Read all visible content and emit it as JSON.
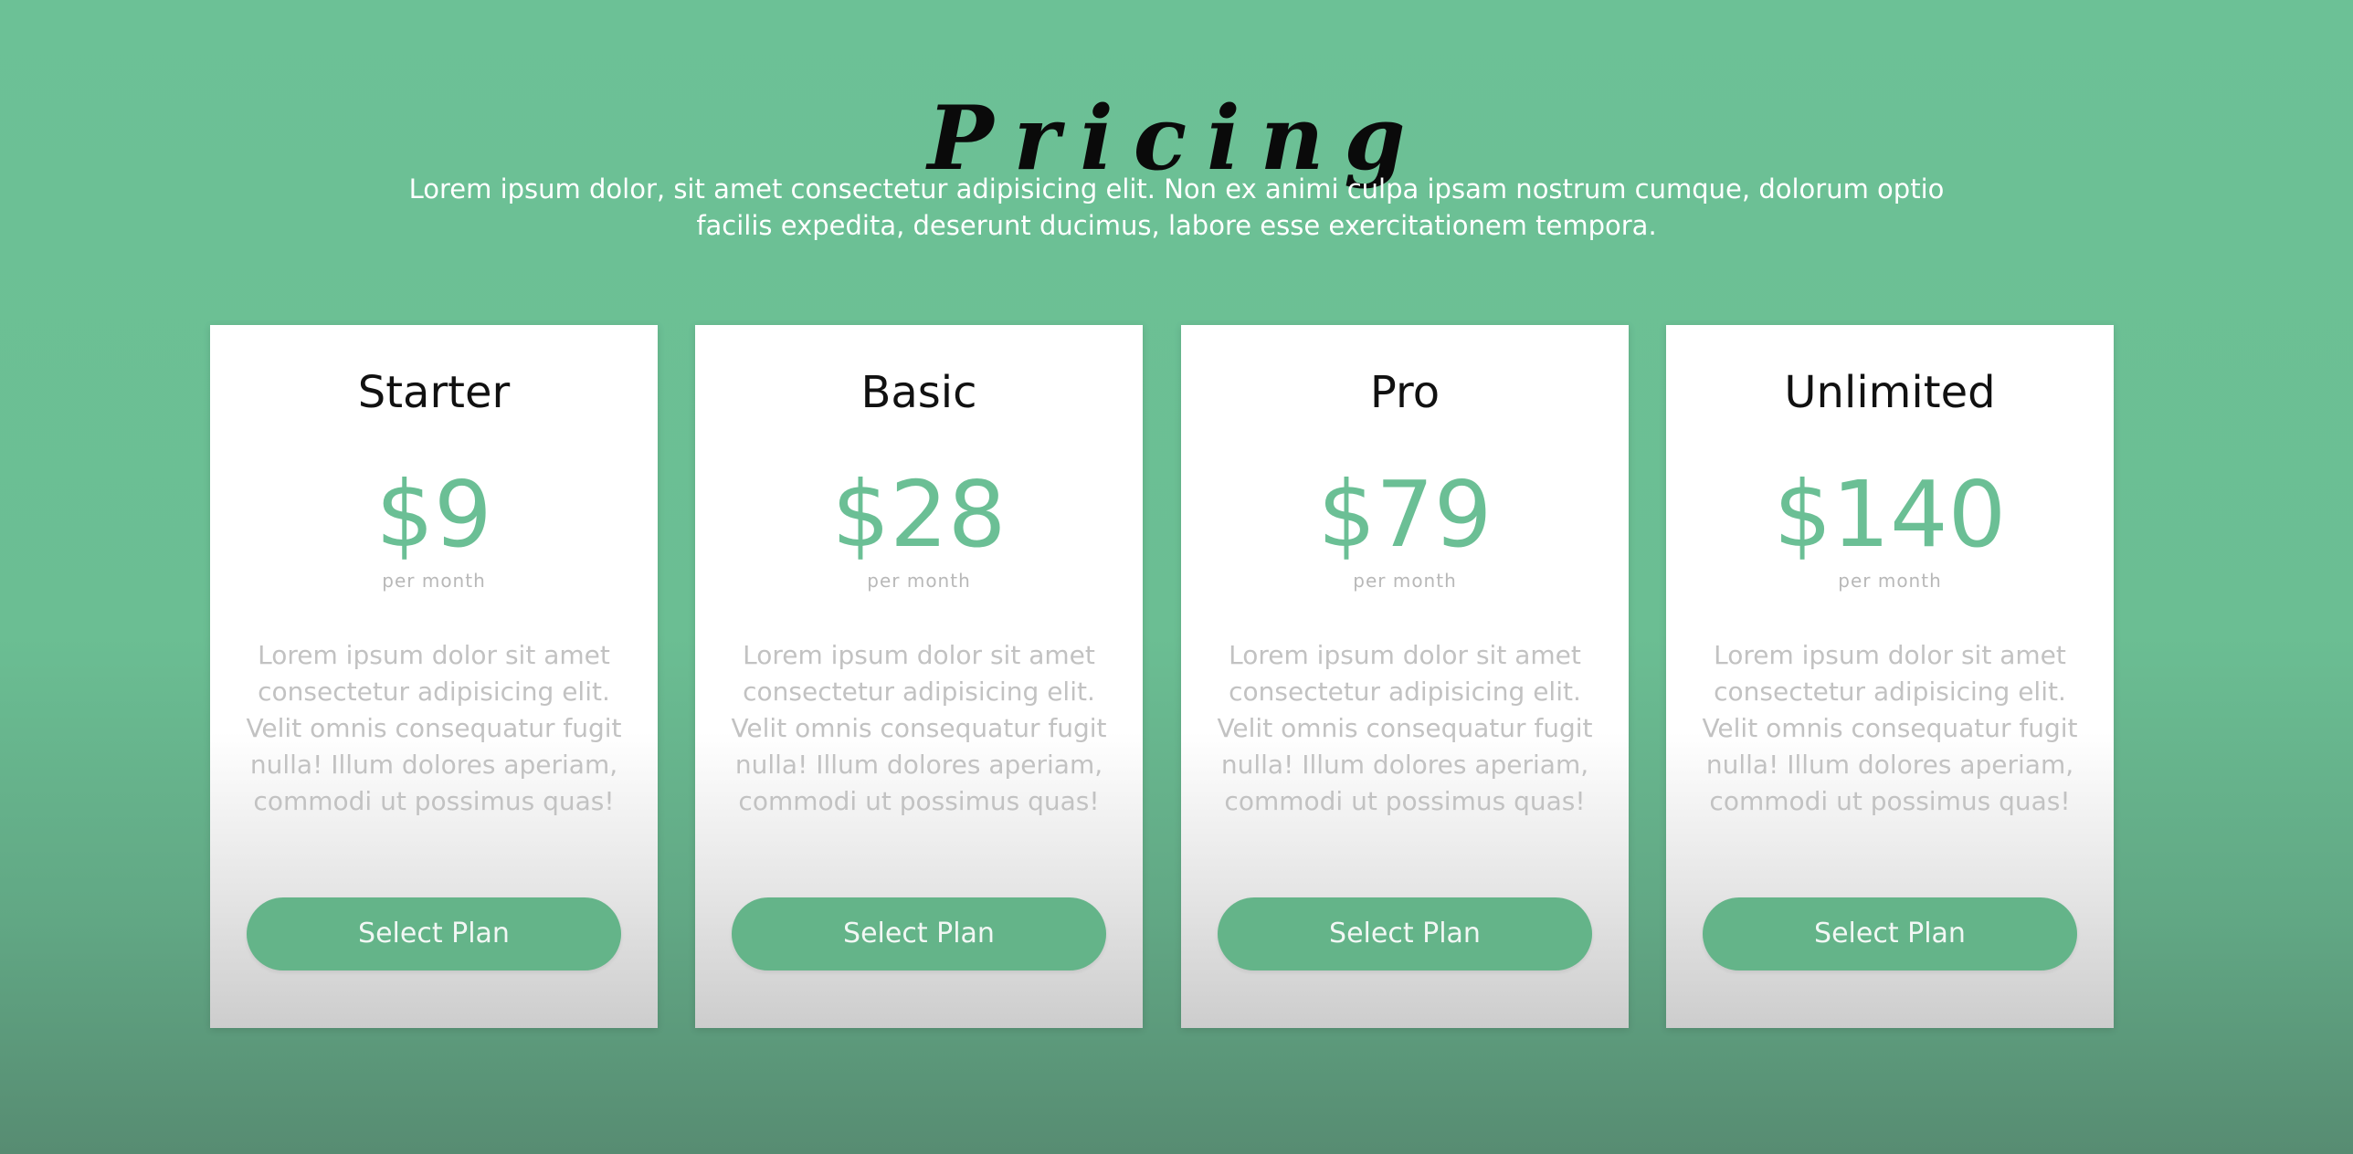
{
  "header": {
    "title": "Pricing",
    "subtitle": "Lorem ipsum dolor, sit amet consectetur adipisicing elit. Non ex animi culpa ipsam nostrum cumque, dolorum optio facilis expedita, deserunt ducimus, labore esse exercitationem tempora."
  },
  "plans": [
    {
      "name": "Starter",
      "price": "$9",
      "period": "per month",
      "description": "Lorem ipsum dolor sit amet consectetur adipisicing elit. Velit omnis consequatur fugit nulla! Illum dolores aperiam, commodi ut possimus quas!",
      "button_label": "Select Plan"
    },
    {
      "name": "Basic",
      "price": "$28",
      "period": "per month",
      "description": "Lorem ipsum dolor sit amet consectetur adipisicing elit. Velit omnis consequatur fugit nulla! Illum dolores aperiam, commodi ut possimus quas!",
      "button_label": "Select Plan"
    },
    {
      "name": "Pro",
      "price": "$79",
      "period": "per month",
      "description": "Lorem ipsum dolor sit amet consectetur adipisicing elit. Velit omnis consequatur fugit nulla! Illum dolores aperiam, commodi ut possimus quas!",
      "button_label": "Select Plan"
    },
    {
      "name": "Unlimited",
      "price": "$140",
      "period": "per month",
      "description": "Lorem ipsum dolor sit amet consectetur adipisicing elit. Velit omnis consequatur fugit nulla! Illum dolores aperiam, commodi ut possimus quas!",
      "button_label": "Select Plan"
    }
  ],
  "colors": {
    "background": "#6cc196",
    "accent": "#6bbf95",
    "button": "#64b489",
    "card": "#ffffff"
  }
}
